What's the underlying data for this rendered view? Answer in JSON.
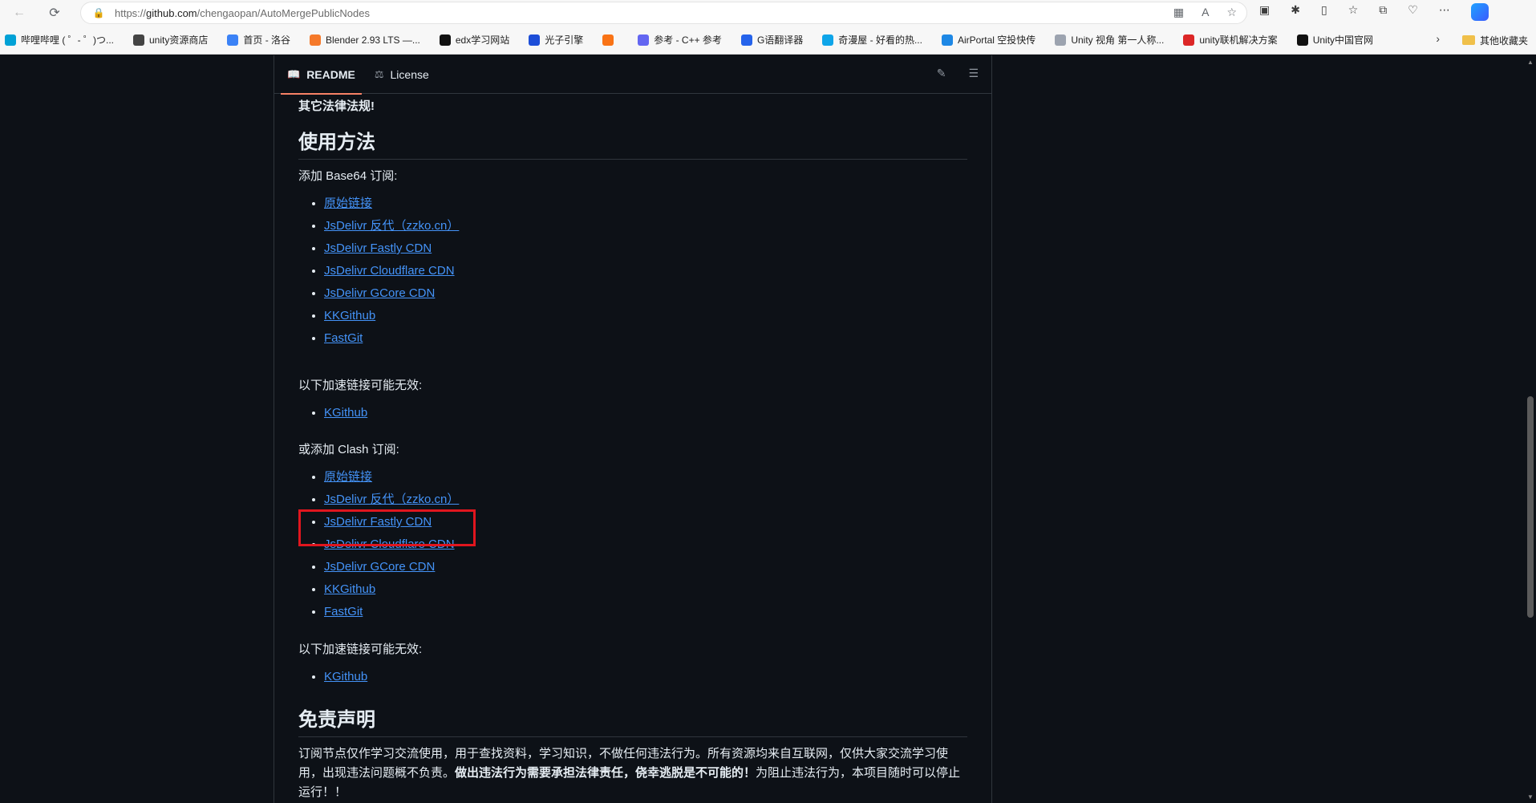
{
  "browser": {
    "url_prefix": "https://",
    "url_domain": "github.com",
    "url_path": "/chengaopan/AutoMergePublicNodes",
    "bookmarks": [
      {
        "label": "哔哩哔哩 ( ゜- ゜)つ...",
        "color": "#00a1d6"
      },
      {
        "label": "unity资源商店",
        "color": "#444444"
      },
      {
        "label": "首页 - 洛谷",
        "color": "#3b82f6"
      },
      {
        "label": "Blender 2.93 LTS —...",
        "color": "#f5792a"
      },
      {
        "label": "edx学习网站",
        "color": "#111111"
      },
      {
        "label": "光子引擎",
        "color": "#1d4ed8"
      },
      {
        "label": "",
        "color": "#f97316"
      },
      {
        "label": "参考 - C++ 参考",
        "color": "#6366f1"
      },
      {
        "label": "G语翻译器",
        "color": "#2563eb"
      },
      {
        "label": "奇漫屋 - 好看的热...",
        "color": "#0ea5e9"
      },
      {
        "label": "AirPortal 空投快传",
        "color": "#1e88e5"
      },
      {
        "label": "Unity 视角 第一人称...",
        "color": "#9ca3af"
      },
      {
        "label": "unity联机解决方案",
        "color": "#dc2626"
      },
      {
        "label": "Unity中国官网",
        "color": "#111111"
      }
    ],
    "other_bookmarks": "其他收藏夹"
  },
  "readme": {
    "tabs": [
      "README",
      "License"
    ],
    "prev_bold": "其它法律法规!",
    "usage_heading": "使用方法",
    "base64_text": "添加 Base64 订阅:",
    "base64_links": [
      "原始链接",
      "JsDelivr 反代（zzko.cn）",
      "JsDelivr Fastly CDN",
      "JsDelivr Cloudflare CDN",
      "JsDelivr GCore CDN",
      "KKGithub",
      "FastGit"
    ],
    "maybe_invalid_1": "以下加速链接可能无效:",
    "invalid_links_1": [
      "KGithub"
    ],
    "clash_text": "或添加 Clash 订阅:",
    "clash_links": [
      "原始链接",
      "JsDelivr 反代（zzko.cn）",
      "JsDelivr Fastly CDN",
      "JsDelivr Cloudflare CDN",
      "JsDelivr GCore CDN",
      "KKGithub",
      "FastGit"
    ],
    "maybe_invalid_2": "以下加速链接可能无效:",
    "invalid_links_2": [
      "KGithub"
    ],
    "disclaimer_heading": "免责声明",
    "disclaimer_part1": "订阅节点仅作学习交流使用，用于查找资料，学习知识，不做任何违法行为。所有资源均来自互联网，仅供大家交流学习使用，出现违法问题概不负责。",
    "disclaimer_bold": "做出违法行为需要承担法律责任，侥幸逃脱是不可能的！",
    "disclaimer_part2": "为阻止违法行为，本项目随时可以停止运行！！"
  },
  "colors": {
    "link": "#4493f8",
    "highlight": "#e0161e",
    "active_tab_underline": "#f78166"
  }
}
